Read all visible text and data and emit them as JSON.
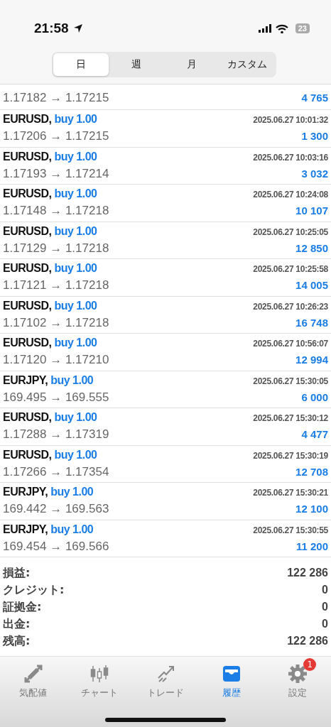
{
  "status_bar": {
    "time": "21:58",
    "battery": "23"
  },
  "tabs": [
    {
      "label": "日",
      "selected": true
    },
    {
      "label": "週",
      "selected": false
    },
    {
      "label": "月",
      "selected": false
    },
    {
      "label": "カスタム",
      "selected": false
    }
  ],
  "partial_row": {
    "prices": "1.17182 → 1.17215",
    "profit": "4 765"
  },
  "deals": [
    {
      "symbol": "EURUSD,",
      "action": "buy 1.00",
      "time": "2025.06.27 10:01:32",
      "prices": "1.17206 → 1.17215",
      "profit": "1 300"
    },
    {
      "symbol": "EURUSD,",
      "action": "buy 1.00",
      "time": "2025.06.27 10:03:16",
      "prices": "1.17193 → 1.17214",
      "profit": "3 032"
    },
    {
      "symbol": "EURUSD,",
      "action": "buy 1.00",
      "time": "2025.06.27 10:24:08",
      "prices": "1.17148 → 1.17218",
      "profit": "10 107"
    },
    {
      "symbol": "EURUSD,",
      "action": "buy 1.00",
      "time": "2025.06.27 10:25:05",
      "prices": "1.17129 → 1.17218",
      "profit": "12 850"
    },
    {
      "symbol": "EURUSD,",
      "action": "buy 1.00",
      "time": "2025.06.27 10:25:58",
      "prices": "1.17121 → 1.17218",
      "profit": "14 005"
    },
    {
      "symbol": "EURUSD,",
      "action": "buy 1.00",
      "time": "2025.06.27 10:26:23",
      "prices": "1.17102 → 1.17218",
      "profit": "16 748"
    },
    {
      "symbol": "EURUSD,",
      "action": "buy 1.00",
      "time": "2025.06.27 10:56:07",
      "prices": "1.17120 → 1.17210",
      "profit": "12 994"
    },
    {
      "symbol": "EURJPY,",
      "action": "buy 1.00",
      "time": "2025.06.27 15:30:05",
      "prices": "169.495 → 169.555",
      "profit": "6 000"
    },
    {
      "symbol": "EURUSD,",
      "action": "buy 1.00",
      "time": "2025.06.27 15:30:12",
      "prices": "1.17288 → 1.17319",
      "profit": "4 477"
    },
    {
      "symbol": "EURUSD,",
      "action": "buy 1.00",
      "time": "2025.06.27 15:30:19",
      "prices": "1.17266 → 1.17354",
      "profit": "12 708"
    },
    {
      "symbol": "EURJPY,",
      "action": "buy 1.00",
      "time": "2025.06.27 15:30:21",
      "prices": "169.442 → 169.563",
      "profit": "12 100"
    },
    {
      "symbol": "EURJPY,",
      "action": "buy 1.00",
      "time": "2025.06.27 15:30:55",
      "prices": "169.454 → 169.566",
      "profit": "11 200"
    }
  ],
  "summary": [
    {
      "label": "損益:",
      "value": "122 286"
    },
    {
      "label": "クレジット:",
      "value": "0"
    },
    {
      "label": "証拠金:",
      "value": "0"
    },
    {
      "label": "出金:",
      "value": "0"
    },
    {
      "label": "残高:",
      "value": "122 286"
    }
  ],
  "tab_bar": [
    {
      "kind": "quotes",
      "label": "気配値",
      "selected": false
    },
    {
      "kind": "chart",
      "label": "チャート",
      "selected": false
    },
    {
      "kind": "trade",
      "label": "トレード",
      "selected": false
    },
    {
      "kind": "history",
      "label": "履歴",
      "selected": true
    },
    {
      "kind": "settings",
      "label": "設定",
      "selected": false,
      "badge": "1"
    }
  ]
}
